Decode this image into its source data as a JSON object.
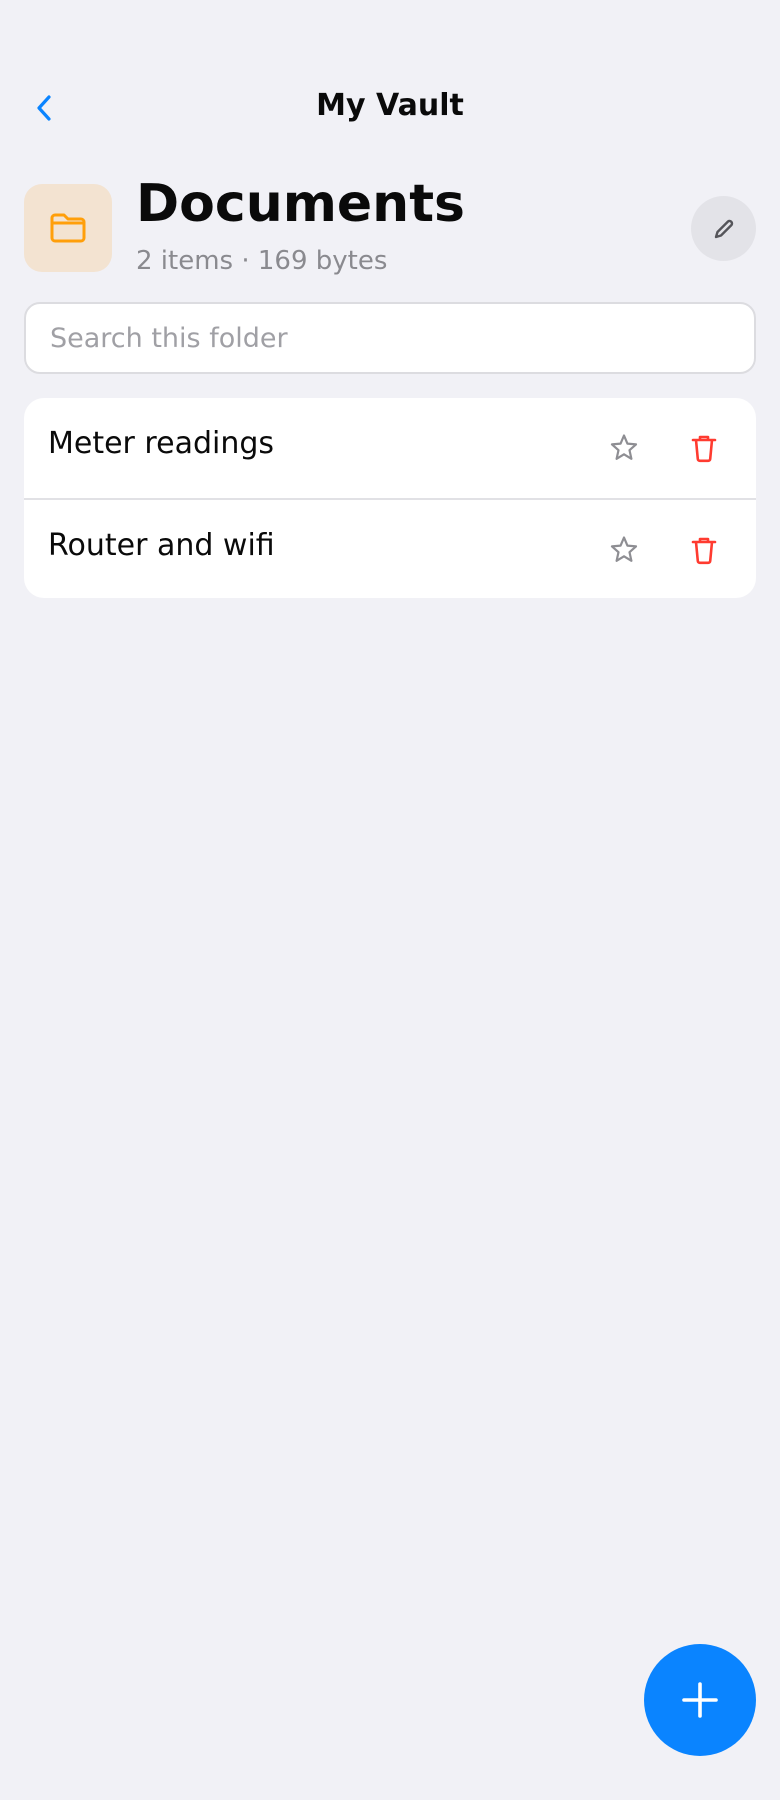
{
  "nav": {
    "title": "My Vault",
    "back_icon": "chevron-left-icon"
  },
  "folder": {
    "icon": "folder-icon",
    "name": "Documents",
    "meta": "2 items · 169 bytes",
    "edit_icon": "pencil-icon"
  },
  "search": {
    "placeholder": "Search this folder",
    "value": ""
  },
  "items": [
    {
      "label": "Meter readings"
    },
    {
      "label": "Router and wifi"
    }
  ],
  "fab": {
    "icon": "plus-icon"
  },
  "colors": {
    "accent": "#0a84ff",
    "folder_tile_bg": "#f3e3d1",
    "folder_icon": "#ff9f0a",
    "danger": "#ff3b30",
    "background": "#f1f1f6"
  }
}
